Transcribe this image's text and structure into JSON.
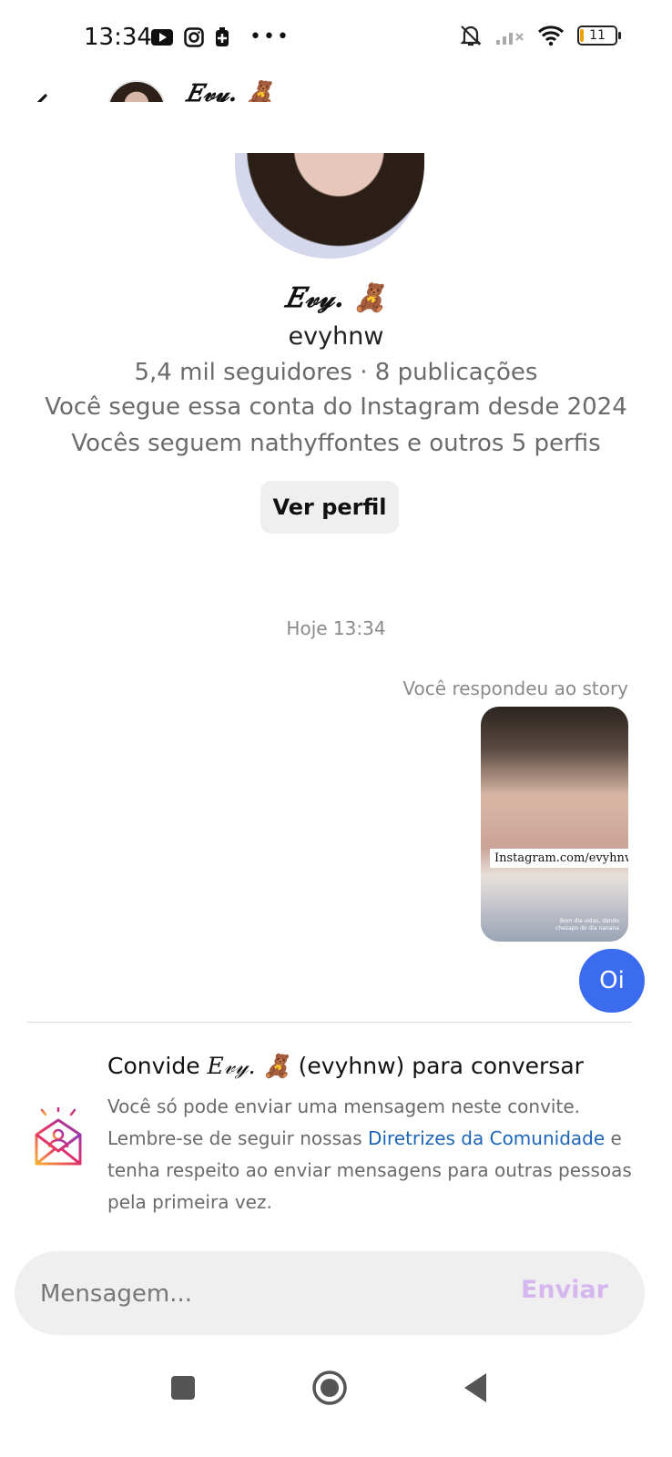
{
  "status_bar": {
    "time": "13:34",
    "battery": "11"
  },
  "header": {
    "display_name": "𝐸𝓋𝓎. 🧸",
    "username": "evyhnw"
  },
  "profile": {
    "display_name": "𝐸𝓋𝓎. 🧸",
    "username": "evyhnw",
    "stats": "5,4 mil seguidores · 8 publicações",
    "following_since": "Você segue essa conta do Instagram desde 2024",
    "mutuals": "Vocês seguem nathyffontes e outros 5 perfis",
    "view_profile_label": "Ver perfil"
  },
  "chat": {
    "timestamp": "Hoje 13:34",
    "story_reply_label": "Você respondeu ao story",
    "story_link_text": "Instagram.com/evyhnw",
    "story_caption": "Bom dia vidas, dando chesapo do dia nanana",
    "sent_message": "Oi"
  },
  "invite": {
    "title_prefix": "Convide",
    "title_name": "𝐸𝓋𝓎. 🧸",
    "title_suffix": "(evyhnw) para conversar",
    "body_part1": "Você só pode enviar uma mensagem neste convite. Lembre-se de seguir nossas",
    "body_link": "Diretrizes da Comunidade",
    "body_part2": "e tenha respeito ao enviar mensagens para outras pessoas pela primeira vez."
  },
  "composer": {
    "placeholder": "Mensagem...",
    "send_label": "Enviar"
  },
  "colors": {
    "accent_blue": "#3b6cf0",
    "link_blue": "#1c64b8",
    "send_disabled": "#d5b6ef"
  }
}
